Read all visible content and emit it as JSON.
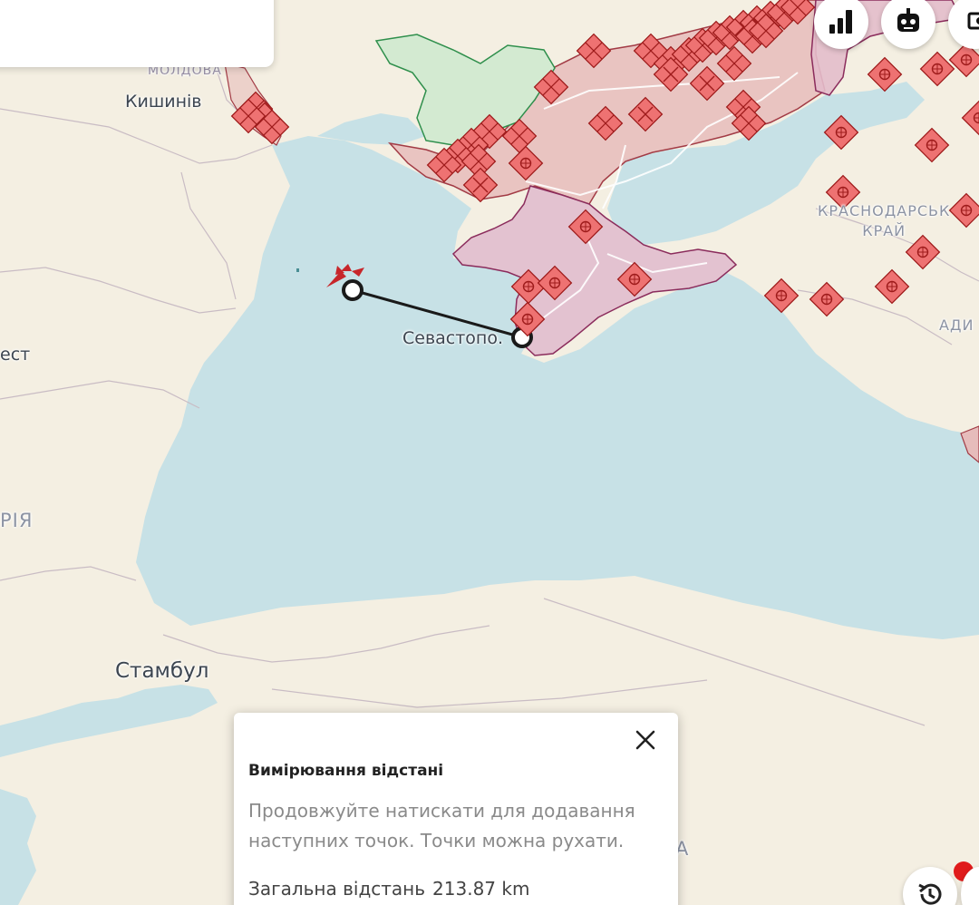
{
  "map": {
    "labels": {
      "moldova": "МОЛДОВА",
      "chisinau": "Кишинів",
      "krasnodar_line1": "КРАСНОДАРСЬК",
      "krasnodar_line2": "КРАЙ",
      "adygea": "АДИ",
      "bucharest_fragment": "ест",
      "romania_fragment": "РІЯ",
      "sevastopol": "Севастопо.",
      "istanbul": "Стамбул",
      "partial_a": "А"
    },
    "colors": {
      "sea": "#c7e1e6",
      "land": "#f4efe2",
      "occupied_fill": "#e6bcbb",
      "occupied_border": "#a23b45",
      "crimea_fill": "#e3c2d0",
      "crimea_border": "#8b2c5c",
      "liberated_fill": "#d3ead1",
      "liberated_border": "#2f8f4c",
      "marker_fill": "#ee7272",
      "marker_stroke": "#9e1b1b",
      "route_line": "#1a1a1a"
    },
    "measure_points": [
      {
        "name": "sea-point",
        "lat": 44.75,
        "lon": 31.25
      },
      {
        "name": "sevastopol-point",
        "lat": 44.6,
        "lon": 33.5
      }
    ]
  },
  "buttons": {
    "stats": "stats-icon",
    "robot": "robot-icon",
    "money": "money-icon",
    "history": "history-icon"
  },
  "measure_panel": {
    "title": "Вимірювання відстані",
    "description": "Продовжуйте натискати для додавання наступних точок. Точки можна рухати.",
    "total_label": "Загальна відстань",
    "total_value": "213.87 km"
  }
}
